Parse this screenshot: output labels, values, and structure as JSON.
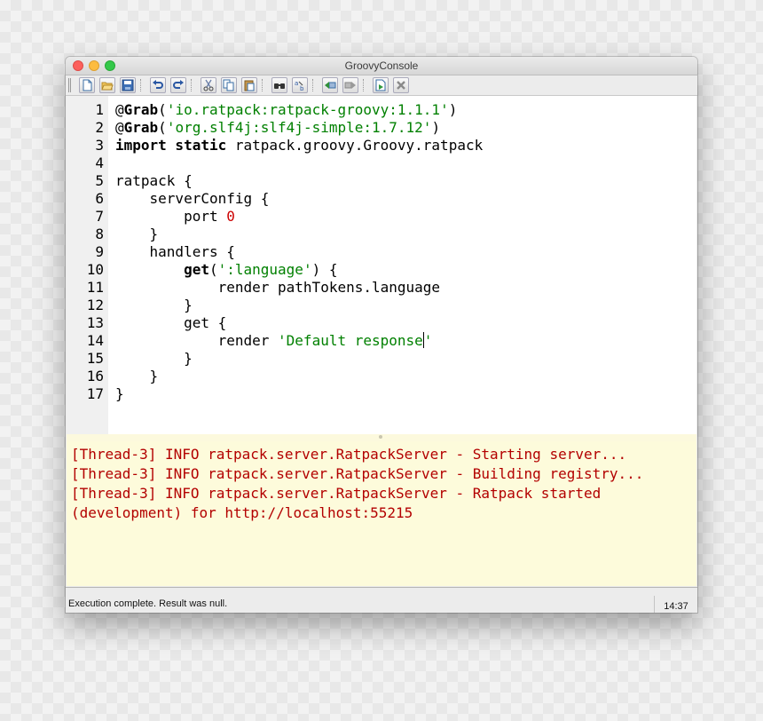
{
  "window": {
    "title": "GroovyConsole"
  },
  "toolbar": {
    "icons": [
      "new-file-icon",
      "open-file-icon",
      "save-file-icon",
      "undo-icon",
      "redo-icon",
      "cut-icon",
      "copy-icon",
      "paste-icon",
      "find-icon",
      "replace-icon",
      "history-prev-icon",
      "history-next-icon",
      "run-script-icon",
      "interrupt-icon"
    ]
  },
  "editor": {
    "line_numbers": [
      "1",
      "2",
      "3",
      "4",
      "5",
      "6",
      "7",
      "8",
      "9",
      "10",
      "11",
      "12",
      "13",
      "14",
      "15",
      "16",
      "17"
    ],
    "lines": [
      {
        "segments": [
          {
            "t": "@",
            "c": "plain"
          },
          {
            "t": "Grab",
            "c": "kw"
          },
          {
            "t": "(",
            "c": "plain"
          },
          {
            "t": "'io.ratpack:ratpack-groovy:1.1.1'",
            "c": "str"
          },
          {
            "t": ")",
            "c": "plain"
          }
        ]
      },
      {
        "segments": [
          {
            "t": "@",
            "c": "plain"
          },
          {
            "t": "Grab",
            "c": "kw"
          },
          {
            "t": "(",
            "c": "plain"
          },
          {
            "t": "'org.slf4j:slf4j-simple:1.7.12'",
            "c": "str"
          },
          {
            "t": ")",
            "c": "plain"
          }
        ]
      },
      {
        "segments": [
          {
            "t": "import static",
            "c": "kw"
          },
          {
            "t": " ratpack.groovy.Groovy.ratpack",
            "c": "plain"
          }
        ]
      },
      {
        "segments": []
      },
      {
        "segments": [
          {
            "t": "ratpack {",
            "c": "plain"
          }
        ]
      },
      {
        "segments": [
          {
            "t": "    serverConfig {",
            "c": "plain"
          }
        ]
      },
      {
        "segments": [
          {
            "t": "        port ",
            "c": "plain"
          },
          {
            "t": "0",
            "c": "num"
          }
        ]
      },
      {
        "segments": [
          {
            "t": "    }",
            "c": "plain"
          }
        ]
      },
      {
        "segments": [
          {
            "t": "    handlers {",
            "c": "plain"
          }
        ]
      },
      {
        "segments": [
          {
            "t": "        ",
            "c": "plain"
          },
          {
            "t": "get",
            "c": "kw"
          },
          {
            "t": "(",
            "c": "plain"
          },
          {
            "t": "':language'",
            "c": "str"
          },
          {
            "t": ") {",
            "c": "plain"
          }
        ]
      },
      {
        "segments": [
          {
            "t": "            render pathTokens.language",
            "c": "plain"
          }
        ]
      },
      {
        "segments": [
          {
            "t": "        }",
            "c": "plain"
          }
        ]
      },
      {
        "segments": [
          {
            "t": "        get {",
            "c": "plain"
          }
        ]
      },
      {
        "segments": [
          {
            "t": "            render ",
            "c": "plain"
          },
          {
            "t": "'Default response",
            "c": "str"
          },
          {
            "t": "",
            "c": "caret"
          },
          {
            "t": "'",
            "c": "str"
          }
        ]
      },
      {
        "segments": [
          {
            "t": "        }",
            "c": "plain"
          }
        ]
      },
      {
        "segments": [
          {
            "t": "    }",
            "c": "plain"
          }
        ]
      },
      {
        "segments": [
          {
            "t": "}",
            "c": "plain"
          }
        ]
      }
    ]
  },
  "output": {
    "lines": [
      "[Thread-3] INFO ratpack.server.RatpackServer - Starting server...",
      "[Thread-3] INFO ratpack.server.RatpackServer - Building registry...",
      "[Thread-3] INFO ratpack.server.RatpackServer - Ratpack started",
      "(development) for http://localhost:55215"
    ]
  },
  "status": {
    "message": "Execution complete. Result was null.",
    "time": "14:37"
  }
}
